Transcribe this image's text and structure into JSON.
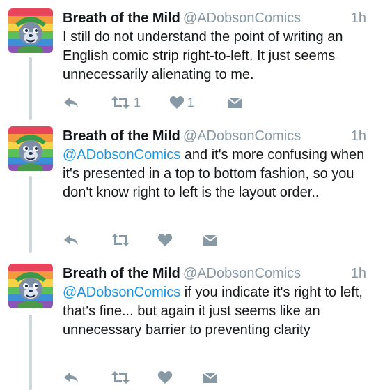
{
  "colors": {
    "name": "#14171a",
    "meta": "#8899a6",
    "link": "#1b95e0",
    "thread_line": "#ccd6dd",
    "icon": "#8899a6"
  },
  "icons": {
    "reply": "reply-arrow-icon",
    "retweet": "retweet-icon",
    "like": "heart-icon",
    "dm": "envelope-icon"
  },
  "tweets": [
    {
      "name": "Breath of the Mild",
      "handle": "@ADobsonComics",
      "time": "1h",
      "mention": "",
      "text": "I still do not understand the point of writing an English comic strip right-to-left. It just seems unnecessarily alienating to me.",
      "retweet_count": "1",
      "like_count": "1"
    },
    {
      "name": "Breath of the Mild",
      "handle": "@ADobsonComics",
      "time": "1h",
      "mention": "@ADobsonComics",
      "text": " and it's more confusing when it's presented in a top to bottom fashion, so you don't know right to left is the layout order..",
      "retweet_count": "",
      "like_count": ""
    },
    {
      "name": "Breath of the Mild",
      "handle": "@ADobsonComics",
      "time": "1h",
      "mention": "@ADobsonComics",
      "text": " if you indicate it's right to left, that's fine... but again it just seems like an unnecessary barrier to preventing clarity",
      "retweet_count": "",
      "like_count": ""
    }
  ]
}
